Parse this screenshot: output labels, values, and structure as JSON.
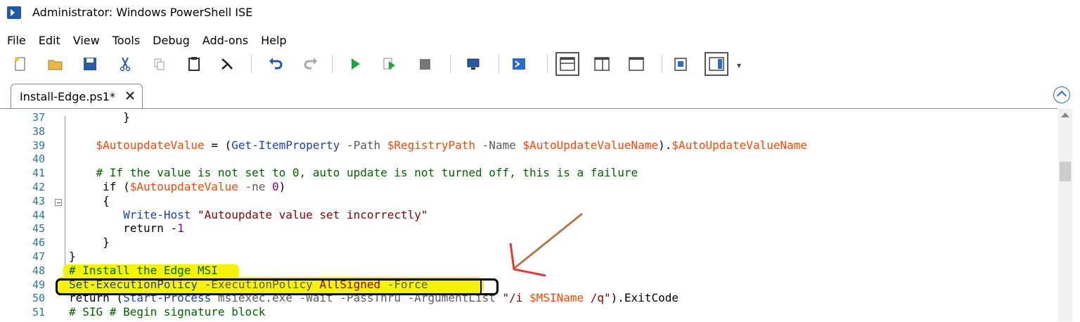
{
  "window": {
    "title": "Administrator: Windows PowerShell ISE"
  },
  "menu": [
    "File",
    "Edit",
    "View",
    "Tools",
    "Debug",
    "Add-ons",
    "Help"
  ],
  "toolbar": {
    "buttons": [
      "new-icon",
      "open-icon",
      "save-icon",
      "cut-icon",
      "copy-icon",
      "paste-icon",
      "console-icon",
      "undo-icon",
      "redo-icon",
      "run-icon",
      "run-selection-icon",
      "stop-icon",
      "remote-icon",
      "powershell-icon",
      "layout-top-icon",
      "layout-right-icon",
      "layout-max-icon",
      "show-commands-icon",
      "show-addon-icon"
    ],
    "overflow": "▾"
  },
  "tab": {
    "label": "Install-Edge.ps1*",
    "close": "✕"
  },
  "editor": {
    "lines": [
      {
        "n": "37",
        "segments": [
          {
            "t": "        }",
            "c": "plain"
          }
        ]
      },
      {
        "n": "38",
        "segments": []
      },
      {
        "n": "39",
        "segments": [
          {
            "t": "    ",
            "c": "plain"
          },
          {
            "t": "$AutoupdateValue",
            "c": "var"
          },
          {
            "t": " = (",
            "c": "plain"
          },
          {
            "t": "Get-ItemProperty",
            "c": "kw-cmd"
          },
          {
            "t": " -Path ",
            "c": "param"
          },
          {
            "t": "$RegistryPath",
            "c": "var"
          },
          {
            "t": " -Name ",
            "c": "param"
          },
          {
            "t": "$AutoUpdateValueName",
            "c": "var"
          },
          {
            "t": ").",
            "c": "plain"
          },
          {
            "t": "$AutoUpdateValueName",
            "c": "var"
          }
        ]
      },
      {
        "n": "40",
        "segments": []
      },
      {
        "n": "41",
        "segments": [
          {
            "t": "    # If the value is not set to 0, auto update is not turned off, this is a failure",
            "c": "comment"
          }
        ]
      },
      {
        "n": "42",
        "segments": [
          {
            "t": "     if (",
            "c": "plain"
          },
          {
            "t": "$AutoupdateValue",
            "c": "var"
          },
          {
            "t": " -ne ",
            "c": "param"
          },
          {
            "t": "0",
            "c": "num"
          },
          {
            "t": ")",
            "c": "plain"
          }
        ]
      },
      {
        "n": "43",
        "segments": [
          {
            "t": "     {",
            "c": "plain"
          }
        ]
      },
      {
        "n": "44",
        "segments": [
          {
            "t": "        ",
            "c": "plain"
          },
          {
            "t": "Write-Host",
            "c": "kw-cmd"
          },
          {
            "t": " \"Autoupdate value set incorrectly\"",
            "c": "str"
          }
        ]
      },
      {
        "n": "45",
        "segments": [
          {
            "t": "        return -",
            "c": "plain"
          },
          {
            "t": "1",
            "c": "num"
          }
        ]
      },
      {
        "n": "46",
        "segments": [
          {
            "t": "     }",
            "c": "plain"
          }
        ]
      },
      {
        "n": "47",
        "segments": [
          {
            "t": "}",
            "c": "plain"
          }
        ]
      },
      {
        "n": "48",
        "segments": [
          {
            "t": "# Install the Edge MSI",
            "c": "comment"
          }
        ]
      },
      {
        "n": "49",
        "segments": [
          {
            "t": "Set-ExecutionPolicy",
            "c": "kw-cmd"
          },
          {
            "t": " -ExecutionPolicy ",
            "c": "param"
          },
          {
            "t": "AllSigned",
            "c": "str"
          },
          {
            "t": " -Force",
            "c": "param"
          }
        ]
      },
      {
        "n": "50",
        "segments": [
          {
            "t": "return (",
            "c": "plain"
          },
          {
            "t": "Start-Process",
            "c": "kw-cmd"
          },
          {
            "t": " msiexec.exe -Wait -PassThru -ArgumentList ",
            "c": "param"
          },
          {
            "t": "\"/i ",
            "c": "str"
          },
          {
            "t": "$MSIName",
            "c": "var"
          },
          {
            "t": " /q\"",
            "c": "str"
          },
          {
            "t": ").ExitCode",
            "c": "plain"
          }
        ]
      },
      {
        "n": "51",
        "segments": [
          {
            "t": "# SIG # Begin signature block",
            "c": "comment"
          }
        ]
      }
    ]
  },
  "colors": {
    "highlight": "#f6f20c",
    "arrow": "#b07a4c",
    "arrowhead": "#e53935"
  }
}
